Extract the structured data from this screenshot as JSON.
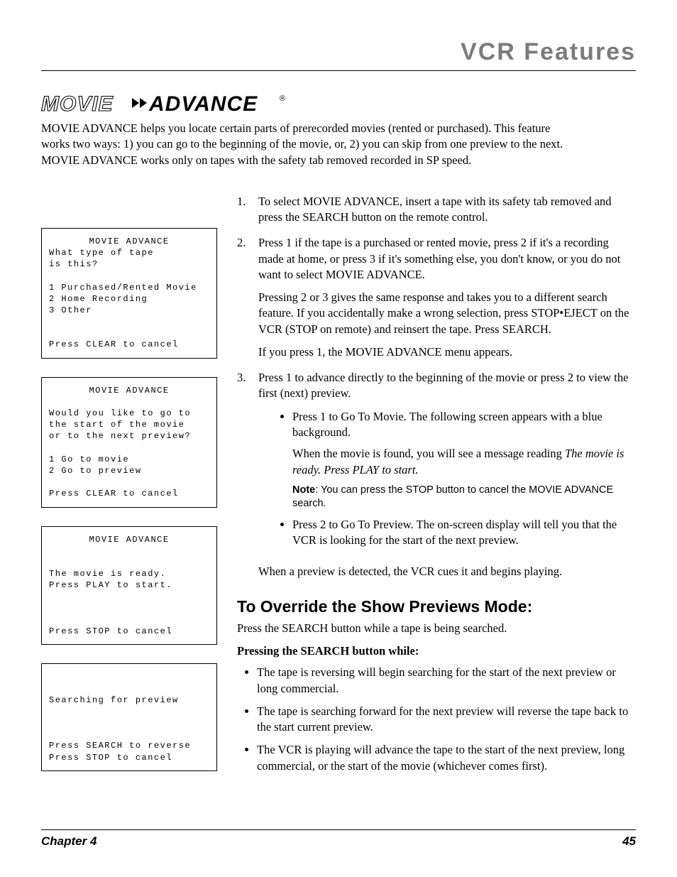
{
  "header": {
    "section_title": "VCR Features"
  },
  "logo": {
    "word1": "MOVIE",
    "word2": "ADVANCE",
    "reg": "®"
  },
  "intro": "MOVIE ADVANCE helps you locate certain parts of prerecorded movies (rented or purchased). This feature works two ways: 1) you can go to the beginning of the movie, or, 2) you can skip from one preview to the next. MOVIE ADVANCE works only on tapes with the safety tab removed recorded in SP speed.",
  "osd": {
    "screen1": {
      "title": "MOVIE ADVANCE",
      "line1": "What type of tape",
      "line2": "is this?",
      "opt1": "1 Purchased/Rented Movie",
      "opt2": "2 Home Recording",
      "opt3": "3 Other",
      "footer": "Press CLEAR to cancel"
    },
    "screen2": {
      "title": "MOVIE ADVANCE",
      "line1": "Would you like to go to",
      "line2": "the start of the movie",
      "line3": "or to the next preview?",
      "opt1": "1 Go to movie",
      "opt2": "2 Go to preview",
      "footer": "Press CLEAR to cancel"
    },
    "screen3": {
      "title": "MOVIE ADVANCE",
      "line1": "The movie is ready.",
      "line2": "Press PLAY to start.",
      "footer": "Press STOP to cancel"
    },
    "screen4": {
      "line1": "Searching for preview",
      "foot1": "Press SEARCH to reverse",
      "foot2": "Press STOP to cancel"
    }
  },
  "steps": {
    "s1": "To select MOVIE ADVANCE, insert a tape with its safety tab removed and press the SEARCH button on the remote control.",
    "s2": "Press 1 if the tape is a purchased or rented movie, press 2 if it's a recording made at home, or press 3 if it's something else, you don't know, or you do not want to select MOVIE ADVANCE.",
    "s2p2": "Pressing 2 or 3 gives the same response and takes you to a different search feature. If you accidentally make a wrong selection, press STOP•EJECT on the VCR (STOP on remote) and reinsert the tape. Press SEARCH.",
    "s2p3": "If you press 1, the MOVIE ADVANCE menu appears.",
    "s3": "Press 1 to advance directly to the beginning of the movie or press 2 to view the first (next) preview.",
    "s3b1": "Press 1 to Go To Movie. The following screen appears with a blue background.",
    "s3b1p_pre": "When the movie is found, you will see a message reading ",
    "s3b1p_em": "The movie is ready. Press PLAY to start.",
    "note_label": "Note",
    "note_text": ": You can press the STOP button to  cancel the MOVIE ADVANCE search.",
    "s3b2": "Press 2 to Go To Preview. The on-screen display will tell you that the VCR is looking for the start of the next preview.",
    "s3p_after": "When a preview is detected, the VCR cues it and begins playing."
  },
  "override": {
    "heading": "To Override the Show Previews Mode:",
    "line": "Press the SEARCH button while a tape is being searched.",
    "subhead": "Pressing the SEARCH button while:",
    "b1": "The tape is reversing will begin searching for the start of the next preview or long commercial.",
    "b2": "The tape is searching forward for the next preview will reverse the tape back to the start current preview.",
    "b3": "The VCR is playing will advance the tape to the start of the next preview, long commercial, or the start of the movie (whichever comes first)."
  },
  "footer": {
    "chapter": "Chapter 4",
    "page": "45"
  }
}
